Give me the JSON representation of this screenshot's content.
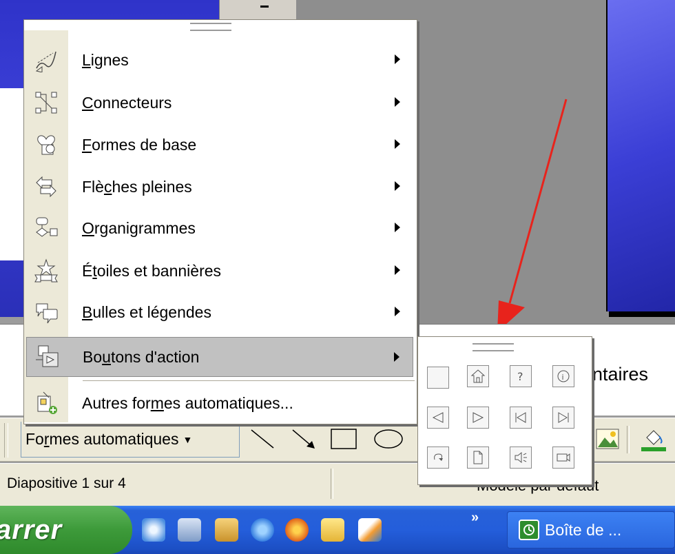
{
  "menu": {
    "items": [
      {
        "prefix": "",
        "accel": "L",
        "suffix": "ignes",
        "icon": "lines-icon",
        "has_submenu": true
      },
      {
        "prefix": "",
        "accel": "C",
        "suffix": "onnecteurs",
        "icon": "connectors-icon",
        "has_submenu": true
      },
      {
        "prefix": "",
        "accel": "F",
        "suffix": "ormes de base",
        "icon": "basic-shapes-icon",
        "has_submenu": true
      },
      {
        "prefix": "Flè",
        "accel": "c",
        "suffix": "hes pleines",
        "icon": "block-arrows-icon",
        "has_submenu": true
      },
      {
        "prefix": "",
        "accel": "O",
        "suffix": "rganigrammes",
        "icon": "flowchart-icon",
        "has_submenu": true
      },
      {
        "prefix": "É",
        "accel": "t",
        "suffix": "oiles et bannières",
        "icon": "stars-banners-icon",
        "has_submenu": true
      },
      {
        "prefix": "",
        "accel": "B",
        "suffix": "ulles et légendes",
        "icon": "callouts-icon",
        "has_submenu": true
      },
      {
        "prefix": "Bo",
        "accel": "u",
        "suffix": "tons d'action",
        "icon": "action-buttons-icon",
        "has_submenu": true,
        "highlighted": true
      },
      {
        "prefix": "Autres for",
        "accel": "m",
        "suffix": "es automatiques...",
        "icon": "more-autoshapes-icon",
        "has_submenu": false
      }
    ]
  },
  "action_buttons_palette": [
    "blank-action-button",
    "home-action-button",
    "help-action-button",
    "information-action-button",
    "back-action-button",
    "forward-action-button",
    "beginning-action-button",
    "end-action-button",
    "return-action-button",
    "document-action-button",
    "sound-action-button",
    "movie-action-button"
  ],
  "drawing_toolbar": {
    "autoshapes": {
      "prefix": "Fo",
      "accel": "r",
      "suffix": "mes automatiques"
    }
  },
  "notes": {
    "partial_text": "ntaires"
  },
  "status_bar": {
    "slide": "Diapositive 1 sur 4",
    "template": "Modèle par défaut"
  },
  "taskbar": {
    "start_label": "arrer",
    "chevron": "»",
    "task_button_label": "Boîte de ..."
  },
  "colors": {
    "menu_highlight": "#c1c1c1",
    "annotation_arrow": "#e8231c",
    "slide_blue": "#3b3fd6",
    "taskbar_blue": "#245edb",
    "start_green": "#3d9a3a"
  }
}
